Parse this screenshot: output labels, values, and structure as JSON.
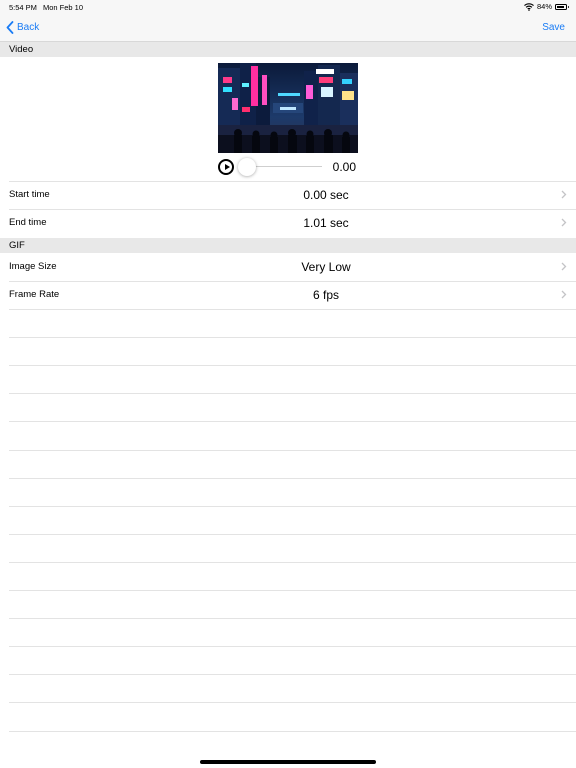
{
  "status_bar": {
    "time": "5:54 PM",
    "date": "Mon Feb 10",
    "battery_text": "84%",
    "battery_level": 0.84
  },
  "nav_bar": {
    "back_label": "Back",
    "save_label": "Save",
    "accent_color": "#1a7cf5"
  },
  "sections": {
    "video_header": "Video",
    "gif_header": "GIF"
  },
  "video": {
    "current_time": "0.00",
    "scrub_position": 0.0
  },
  "settings_rows": {
    "start_time": {
      "label": "Start time",
      "value": "0.00 sec"
    },
    "end_time": {
      "label": "End time",
      "value": "1.01 sec"
    },
    "image_size": {
      "label": "Image Size",
      "value": "Very Low"
    },
    "frame_rate": {
      "label": "Frame Rate",
      "value": "6 fps"
    }
  },
  "icons": {
    "back": "chevron-left-icon",
    "disclosure": "chevron-right-icon",
    "play": "play-icon",
    "wifi": "wifi-icon",
    "battery": "battery-icon"
  }
}
